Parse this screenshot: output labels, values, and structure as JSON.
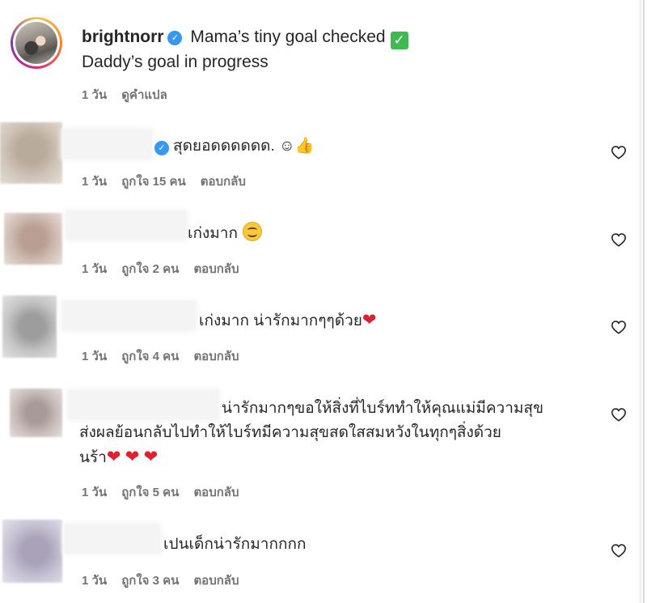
{
  "post": {
    "username": "brightnorr",
    "caption_line1": "Mama’s tiny goal checked",
    "caption_line2": "Daddy’s goal in progress",
    "checkbox_glyph": "✓",
    "verified_glyph": "✓",
    "time": "1 วัน",
    "translate": "ดูคำแปล"
  },
  "comments": [
    {
      "text": "สุดยอดดดดดด. ☺👍",
      "time": "1 วัน",
      "likes": "ถูกใจ 15 คน",
      "reply": "ตอบกลับ"
    },
    {
      "text": "เก่งมาก",
      "time": "1 วัน",
      "likes": "ถูกใจ 2 คน",
      "reply": "ตอบกลับ"
    },
    {
      "text": "เก่งมาก น่ารักมากๆๆด้วย",
      "time": "1 วัน",
      "likes": "ถูกใจ 4 คน",
      "reply": "ตอบกลับ"
    },
    {
      "text_line1": "น่ารักมากๆขอให้สิ่งที่ไบร์ททำให้คุณแม่มีความสุข",
      "text_line2": "ส่งผลย้อนกลับไปทำให้ไบร์ทมีความสุขสดใสสมหวังในทุกๆสิ่งด้วย",
      "text_line3": "นร้า",
      "time": "1 วัน",
      "likes": "ถูกใจ 5 คน",
      "reply": "ตอบกลับ"
    },
    {
      "text": "เปนเด็กน่ารักมากกกก",
      "time": "1 วัน",
      "likes": "ถูกใจ 3 คน",
      "reply": "ตอบกลับ"
    }
  ],
  "icons": {
    "heart_outline": "heart-icon",
    "heart_emoji": "❤",
    "smile": "smiling-face-icon",
    "verified": "verified-badge-icon"
  },
  "colors": {
    "meta_text": "#737373",
    "verified": "#3897f0",
    "heart_emoji": "#e0202f"
  }
}
